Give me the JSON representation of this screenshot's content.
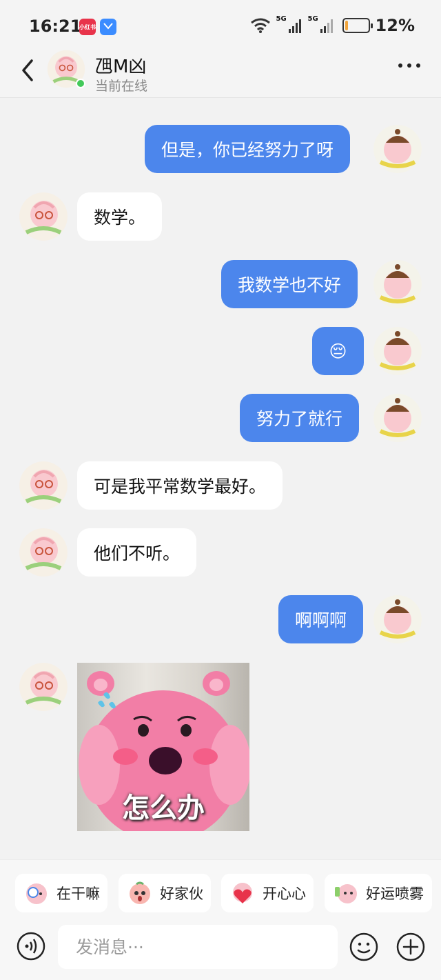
{
  "status_bar": {
    "time": "16:21",
    "app_icon_1_text": "小红书",
    "network_1": "5G",
    "network_2": "5G",
    "battery_percent": "12%",
    "battery_level": 0.12,
    "battery_color": "#f2a43a"
  },
  "header": {
    "contact_name": "乪M凶",
    "contact_status": "当前在线",
    "online_dot_color": "#43c95a"
  },
  "messages": [
    {
      "side": "out",
      "text": "但是，你已经努力了呀"
    },
    {
      "side": "in",
      "text": "数学。"
    },
    {
      "side": "out",
      "text": "我数学也不好"
    },
    {
      "side": "out",
      "text": "😔"
    },
    {
      "side": "out",
      "text": "努力了就行"
    },
    {
      "side": "in",
      "text": "可是我平常数学最好。"
    },
    {
      "side": "in",
      "text": "他们不听。"
    },
    {
      "side": "out",
      "text": "啊啊啊"
    },
    {
      "side": "in",
      "type": "sticker",
      "text": "怎么办"
    }
  ],
  "quick_replies": [
    {
      "label": "在干嘛",
      "icon": "magnifier-sticker-icon"
    },
    {
      "label": "好家伙",
      "icon": "surprised-sticker-icon"
    },
    {
      "label": "开心心",
      "icon": "heart-sticker-icon"
    },
    {
      "label": "好运喷雾",
      "icon": "spray-sticker-icon"
    }
  ],
  "composer": {
    "placeholder": "发消息···"
  },
  "colors": {
    "outgoing_bubble": "#4c86ec",
    "incoming_bubble": "#ffffff",
    "background": "#f2f2f2"
  }
}
